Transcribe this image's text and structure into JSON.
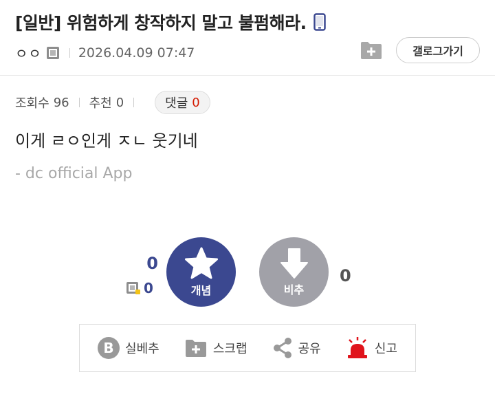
{
  "post": {
    "title": "[일반] 위험하게 창작하지 말고 불펌해라.",
    "author": "ㅇㅇ",
    "date": "2026.04.09 07:47",
    "gallery_button": "갤로그가기"
  },
  "stats": {
    "views_label": "조회수",
    "views": "96",
    "recommend_label": "추천",
    "recommend": "0",
    "reply_label": "댓글",
    "reply_count": "0"
  },
  "content": {
    "text": "이게 ㄹㅇ인게 ㅈㄴ 웃기네",
    "signature": "- dc official App"
  },
  "vote": {
    "up_count": "0",
    "fix_up_count": "0",
    "up_label": "개념",
    "down_label": "비추",
    "down_count": "0"
  },
  "actions": {
    "real_down": "실베추",
    "scrap": "스크랩",
    "share": "공유",
    "report": "신고"
  },
  "colors": {
    "accent": "#3b4890",
    "downvote": "#a1a1a8",
    "reply_count": "#d31900",
    "report_icon": "#e0141c"
  },
  "icons": [
    "phone-icon",
    "fix-member-icon",
    "folder-add-icon",
    "star-icon",
    "arrow-down-icon",
    "b-icon",
    "share-icon",
    "siren-icon"
  ]
}
